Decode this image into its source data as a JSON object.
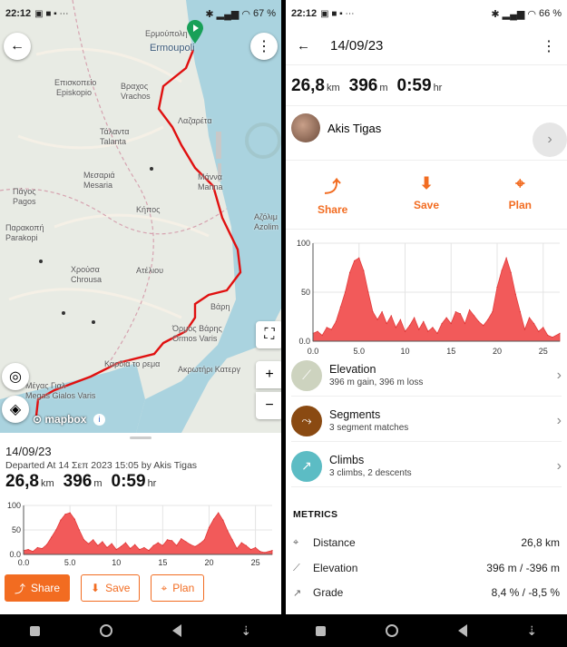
{
  "status_left": {
    "time": "22:12",
    "battery": "67"
  },
  "status_right": {
    "time": "22:12",
    "battery": "66"
  },
  "map": {
    "labels": [
      "Ερμούπολη",
      "Ermoupoli",
      "Επισκοπείο",
      "Episkopio",
      "Βραχος",
      "Vrachos",
      "Τάλαντα",
      "Talanta",
      "Λαζαρέτα",
      "Μεσαριά",
      "Mesaria",
      "Μάννα",
      "Manna",
      "Κήπος",
      "Πάγος",
      "Pagos",
      "Παρακοπή",
      "Parakopi",
      "Αζόλιμ",
      "Azolim",
      "Χρούσα",
      "Chrousa",
      "Ατέλιου",
      "Βάρη",
      "Όρμος Βάρης",
      "Ormos Varis",
      "Καρδιά το ρεμα",
      "Ακρωτήρι Κατεργ",
      "Μέγας Γιαλ",
      "Megas Gialos Varis"
    ],
    "attribution": "mapbox"
  },
  "left": {
    "date": "14/09/23",
    "departed": "Departed At 14 Σεπ 2023 15:05 by Akis Tigas",
    "distance": "26,8",
    "distance_unit": "km",
    "elevation": "396",
    "elevation_unit": "m",
    "time": "0:59",
    "time_unit": "hr",
    "buttons": {
      "share": "Share",
      "save": "Save",
      "plan": "Plan"
    }
  },
  "right": {
    "title": "14/09/23",
    "distance": "26,8",
    "distance_unit": "km",
    "elevation": "396",
    "elevation_unit": "m",
    "time": "0:59",
    "time_unit": "hr",
    "athlete": "Akis Tigas",
    "actions": {
      "share": "Share",
      "save": "Save",
      "plan": "Plan"
    },
    "list": [
      {
        "title": "Elevation",
        "sub": "396 m gain, 396 m loss",
        "color": "#cdd3bf",
        "icon": "elevation-icon"
      },
      {
        "title": "Segments",
        "sub": "3 segment matches",
        "color": "#8a4a12",
        "icon": "segments-icon"
      },
      {
        "title": "Climbs",
        "sub": "3 climbs, 2 descents",
        "color": "#5cbcc4",
        "icon": "climbs-icon"
      }
    ],
    "metrics_header": "METRICS",
    "metrics": [
      {
        "label": "Distance",
        "value": "26,8 km",
        "icon": "distance-icon"
      },
      {
        "label": "Elevation",
        "value": "396 m / -396 m",
        "icon": "elevation-icon"
      },
      {
        "label": "Grade",
        "value": "8,4 % / -8,5 %",
        "icon": "grade-icon"
      }
    ]
  },
  "chart_data": {
    "type": "area",
    "xlabel": "",
    "ylabel": "",
    "xlim": [
      0,
      26.8
    ],
    "ylim": [
      0,
      100
    ],
    "xticks": [
      "0.0",
      "5.0",
      "10",
      "15",
      "20",
      "25"
    ],
    "yticks": [
      "0.0",
      "50",
      "100"
    ],
    "color": "#f25a5a",
    "x": [
      0,
      0.5,
      1,
      1.5,
      2,
      2.5,
      3,
      3.5,
      4,
      4.5,
      5,
      5.5,
      6,
      6.5,
      7,
      7.5,
      8,
      8.5,
      9,
      9.5,
      10,
      10.5,
      11,
      11.5,
      12,
      12.5,
      13,
      13.5,
      14,
      14.5,
      15,
      15.5,
      16,
      16.5,
      17,
      17.5,
      18,
      18.5,
      19,
      19.5,
      20,
      20.5,
      21,
      21.5,
      22,
      22.5,
      23,
      23.5,
      24,
      24.5,
      25,
      25.5,
      26,
      26.8
    ],
    "y": [
      8,
      10,
      6,
      14,
      12,
      20,
      35,
      50,
      70,
      82,
      85,
      72,
      50,
      30,
      22,
      30,
      18,
      26,
      14,
      22,
      10,
      16,
      24,
      12,
      20,
      10,
      14,
      8,
      18,
      24,
      18,
      30,
      28,
      18,
      32,
      26,
      20,
      16,
      22,
      30,
      55,
      72,
      85,
      70,
      48,
      30,
      12,
      24,
      18,
      10,
      14,
      6,
      4,
      8
    ]
  }
}
